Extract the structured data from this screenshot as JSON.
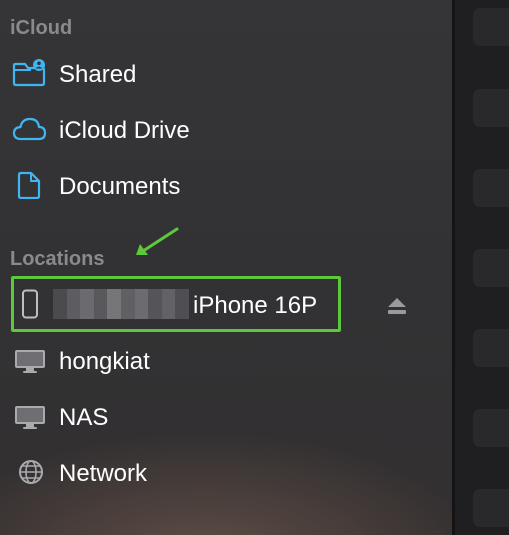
{
  "sidebar": {
    "icloud_header": "iCloud",
    "icloud_items": [
      {
        "label": "Shared",
        "icon": "shared-folder-icon"
      },
      {
        "label": "iCloud Drive",
        "icon": "icloud-icon"
      },
      {
        "label": "Documents",
        "icon": "document-icon"
      }
    ],
    "locations_header": "Locations",
    "device": {
      "label": "iPhone 16P",
      "icon": "iphone-icon",
      "eject_icon": "eject-icon",
      "name_redacted": true
    },
    "location_items": [
      {
        "label": "hongkiat",
        "icon": "computer-icon"
      },
      {
        "label": "NAS",
        "icon": "computer-icon"
      },
      {
        "label": "Network",
        "icon": "network-globe-icon"
      }
    ]
  },
  "annotation": {
    "highlight_color": "#5cc83a",
    "arrow_color": "#5cc83a"
  },
  "colors": {
    "accent": "#3fb6f2",
    "section_header": "#8a8a8e",
    "text": "#ffffff"
  }
}
